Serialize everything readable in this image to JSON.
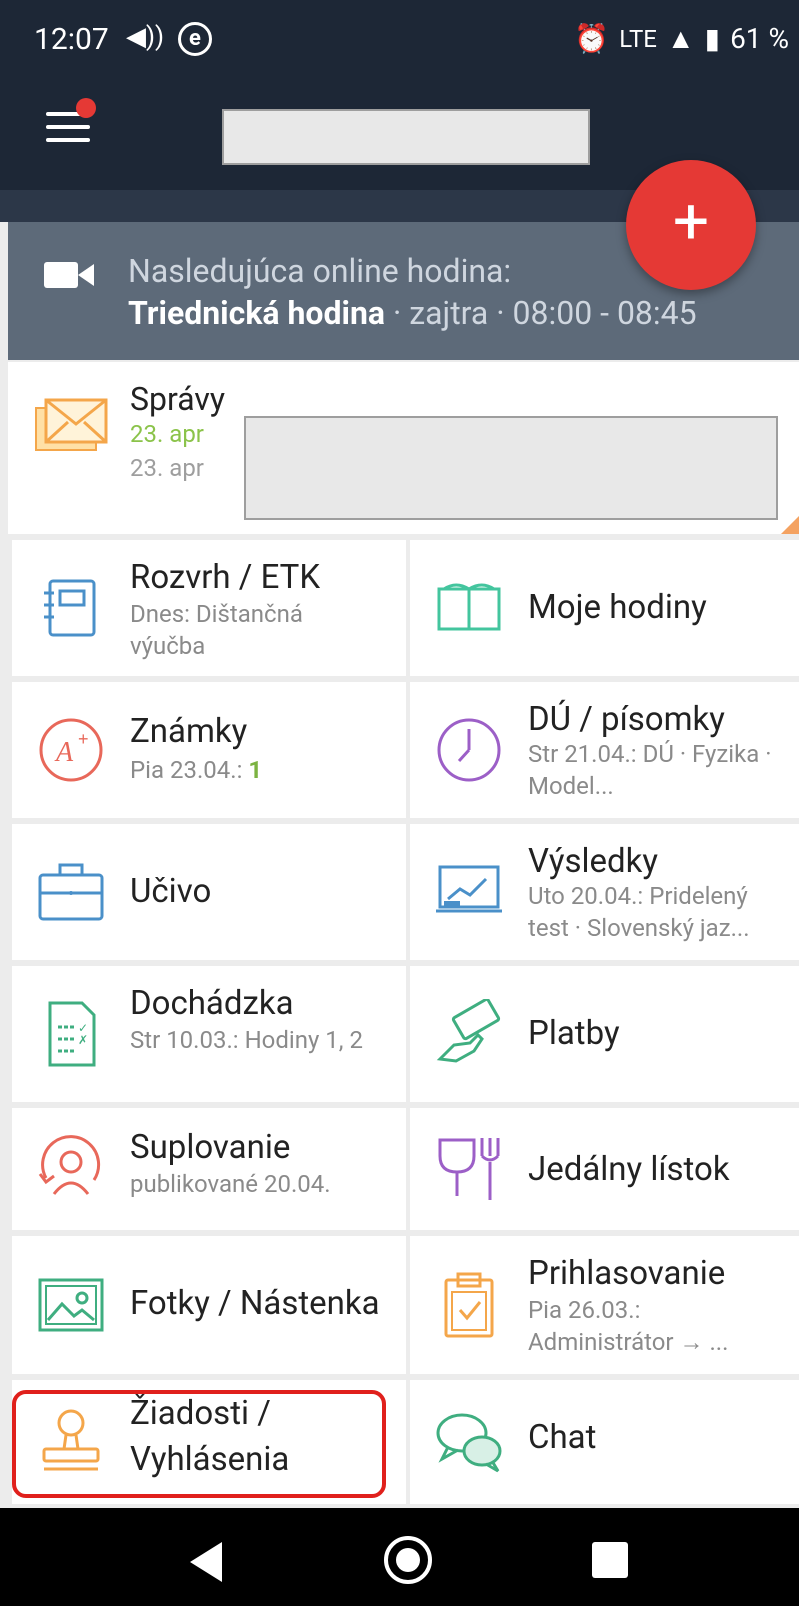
{
  "status_bar": {
    "time": "12:07",
    "network": "LTE",
    "battery": "61 %"
  },
  "online_lesson": {
    "label": "Nasledujúca online hodina:",
    "subject": "Triednická hodina",
    "when": " · zajtra · 08:00 - 08:45"
  },
  "fab": {
    "symbol": "+"
  },
  "messages": {
    "title": "Správy",
    "date1": "23. apr",
    "date2": "23. apr"
  },
  "tiles": {
    "rozvrh": {
      "title": "Rozvrh / ETK",
      "sub": "Dnes: Dištančná výučba"
    },
    "moje_hodiny": {
      "title": "Moje hodiny"
    },
    "znamky": {
      "title": "Známky",
      "sub": "Pia 23.04.: ",
      "grade": "1"
    },
    "du": {
      "title": "DÚ / písomky",
      "sub": "Str 21.04.: DÚ · Fyzika · Model..."
    },
    "ucivo": {
      "title": "Učivo"
    },
    "vysledky": {
      "title": "Výsledky",
      "sub": "Uto 20.04.: Pridelený test · Slovenský jaz..."
    },
    "dochadzka": {
      "title": "Dochádzka",
      "sub": "Str 10.03.: Hodiny 1, 2"
    },
    "platby": {
      "title": "Platby"
    },
    "suplovanie": {
      "title": "Suplovanie",
      "sub": "publikované 20.04."
    },
    "jedalny": {
      "title": "Jedálny lístok"
    },
    "fotky": {
      "title": "Fotky / Nástenka"
    },
    "prihlasovanie": {
      "title": "Prihlasovanie",
      "sub": "Pia 26.03.: Administrátor → ..."
    },
    "ziadosti": {
      "title_line1": "Žiadosti /",
      "title_line2": "Vyhlásenia"
    },
    "chat": {
      "title": "Chat"
    }
  },
  "colors": {
    "header": "#1d2736",
    "online_bar": "#5d6a79",
    "fab": "#e53935",
    "highlight": "#e0201c"
  }
}
